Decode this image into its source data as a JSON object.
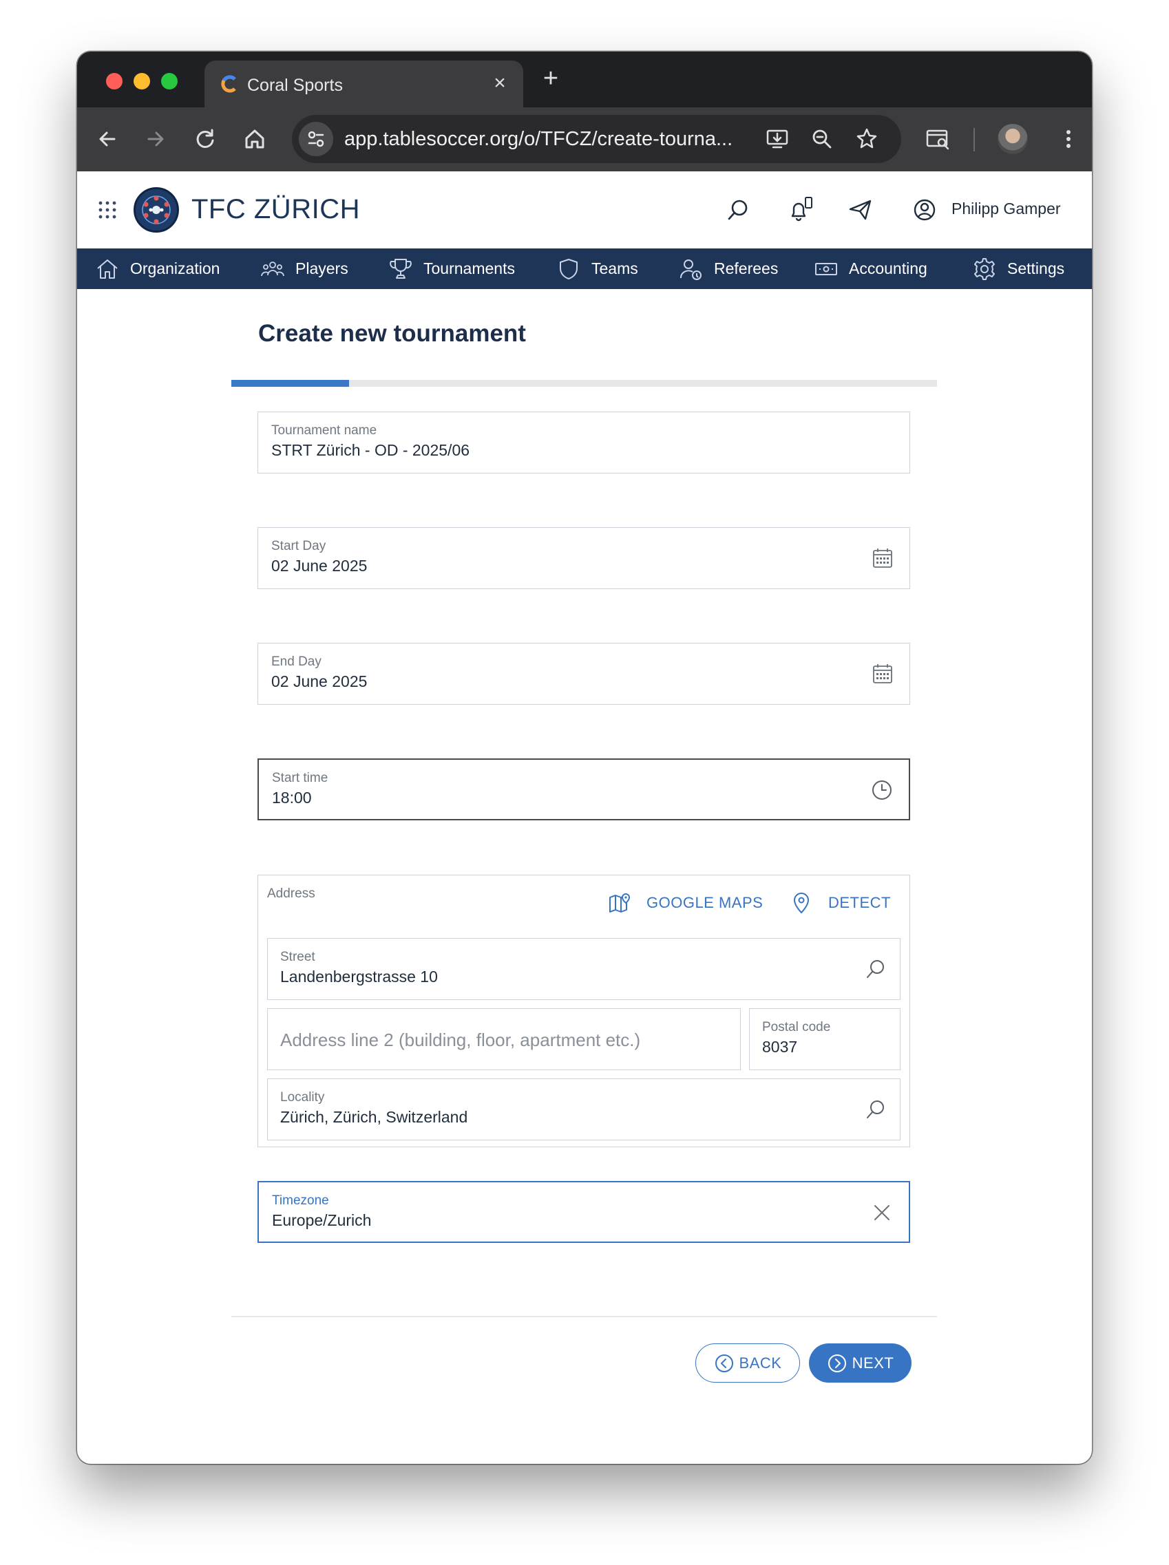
{
  "browser": {
    "tab_title": "Coral Sports",
    "url": "app.tablesoccer.org/o/TFCZ/create-tourna..."
  },
  "header": {
    "org_name": "TFC ZÜRICH",
    "user_name": "Philipp Gamper"
  },
  "nav": {
    "items": [
      {
        "label": "Organization",
        "icon": "home-icon"
      },
      {
        "label": "Players",
        "icon": "players-icon"
      },
      {
        "label": "Tournaments",
        "icon": "trophy-icon"
      },
      {
        "label": "Teams",
        "icon": "shield-icon"
      },
      {
        "label": "Referees",
        "icon": "referee-icon"
      },
      {
        "label": "Accounting",
        "icon": "money-icon"
      },
      {
        "label": "Settings",
        "icon": "gear-icon"
      }
    ]
  },
  "page": {
    "title": "Create new tournament",
    "progress_fraction": 0.167
  },
  "form": {
    "tournament_name": {
      "label": "Tournament name",
      "value": "STRT Zürich - OD - 2025/06"
    },
    "start_day": {
      "label": "Start Day",
      "value": "02 June 2025"
    },
    "end_day": {
      "label": "End Day",
      "value": "02 June 2025"
    },
    "start_time": {
      "label": "Start time",
      "value": "18:00"
    },
    "address": {
      "label": "Address",
      "google_maps_label": "GOOGLE MAPS",
      "detect_label": "DETECT",
      "street": {
        "label": "Street",
        "value": "Landenbergstrasse 10"
      },
      "line2": {
        "placeholder": "Address line 2 (building, floor, apartment etc.)"
      },
      "postal_code": {
        "label": "Postal code",
        "value": "8037"
      },
      "locality": {
        "label": "Locality",
        "value": "Zürich, Zürich, Switzerland"
      }
    },
    "timezone": {
      "label": "Timezone",
      "value": "Europe/Zurich"
    }
  },
  "buttons": {
    "back_label": "BACK",
    "next_label": "NEXT"
  },
  "colors": {
    "nav_bg": "#1f3558",
    "accent": "#3775c4",
    "title": "#1d2d4a"
  }
}
